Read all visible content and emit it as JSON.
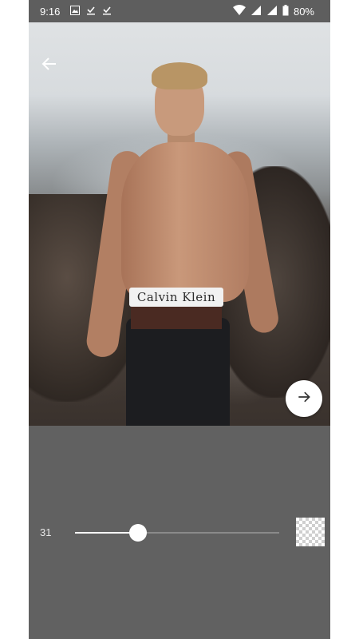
{
  "status_bar": {
    "time": "9:16",
    "left_icons": [
      "image-icon",
      "check-download-icon",
      "check-download-icon"
    ],
    "right_icons": [
      "wifi-icon",
      "signal-icon",
      "signal-icon"
    ],
    "battery": "80%"
  },
  "photo": {
    "waistband_text": "Calvin Klein"
  },
  "controls": {
    "blur_value": "31",
    "slider_fraction": 0.31
  },
  "colors": {
    "panel": "#616161",
    "accent": "#ffffff"
  }
}
